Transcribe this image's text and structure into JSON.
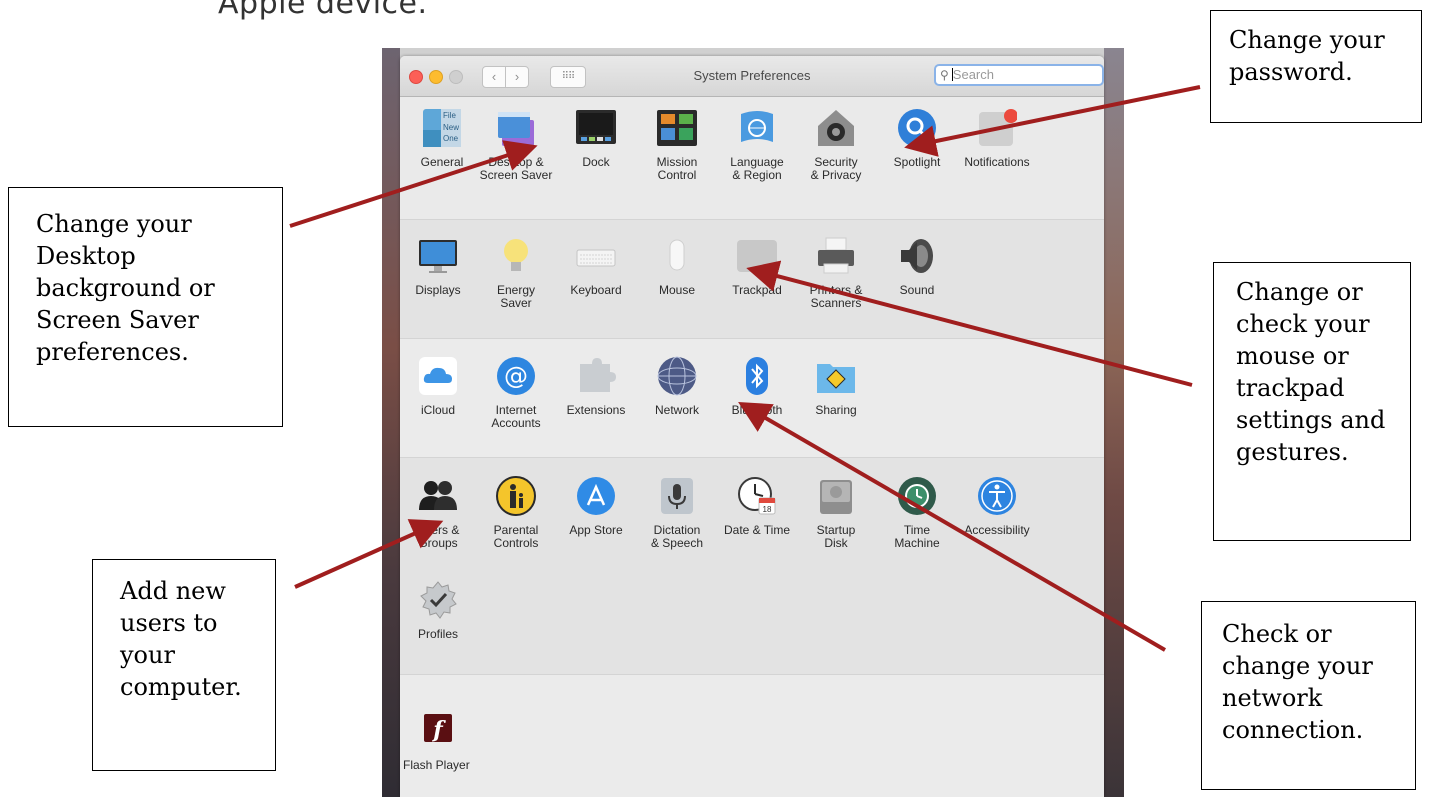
{
  "heading_fragment": "Apple device.",
  "window": {
    "title": "System Preferences",
    "search_placeholder": "Search",
    "nav_back": "‹",
    "nav_forward": "›",
    "grid_glyph": "⠿⠿"
  },
  "prefs": {
    "general": "General",
    "desktop_line1": "Desktop &",
    "desktop_line2": "Screen Saver",
    "dock": "Dock",
    "mission_line1": "Mission",
    "mission_line2": "Control",
    "language_line1": "Language",
    "language_line2": "& Region",
    "security_line1": "Security",
    "security_line2": "& Privacy",
    "spotlight": "Spotlight",
    "notifications": "Notifications",
    "displays": "Displays",
    "energy_line1": "Energy",
    "energy_line2": "Saver",
    "keyboard": "Keyboard",
    "mouse": "Mouse",
    "trackpad": "Trackpad",
    "printers_line1": "Printers &",
    "printers_line2": "Scanners",
    "sound": "Sound",
    "icloud": "iCloud",
    "internet_line1": "Internet",
    "internet_line2": "Accounts",
    "extensions": "Extensions",
    "network": "Network",
    "bluetooth": "Bluetooth",
    "sharing": "Sharing",
    "users_line1": "Users &",
    "users_line2": "Groups",
    "parental_line1": "Parental",
    "parental_line2": "Controls",
    "appstore": "App Store",
    "dictation_line1": "Dictation",
    "dictation_line2": "& Speech",
    "datetime": "Date & Time",
    "startup_line1": "Startup",
    "startup_line2": "Disk",
    "timemachine_line1": "Time",
    "timemachine_line2": "Machine",
    "accessibility": "Accessibility",
    "profiles": "Profiles",
    "flash": "Flash Player",
    "calendar_day": "18",
    "general_icon_text": [
      "File",
      "New",
      "One"
    ]
  },
  "callouts": {
    "password": [
      "Change your",
      "password."
    ],
    "desktop": [
      "Change your",
      "Desktop",
      "background or",
      "Screen Saver",
      "preferences."
    ],
    "mouse": [
      "Change or",
      "check your",
      "mouse or",
      "trackpad",
      "settings and",
      "gestures."
    ],
    "users": [
      "Add new",
      "users to",
      "your",
      "computer."
    ],
    "network": [
      "Check or",
      "change your",
      "network",
      "connection."
    ]
  },
  "colors": {
    "arrow": "#a01e1e",
    "search_focus": "#8ab3e8"
  }
}
